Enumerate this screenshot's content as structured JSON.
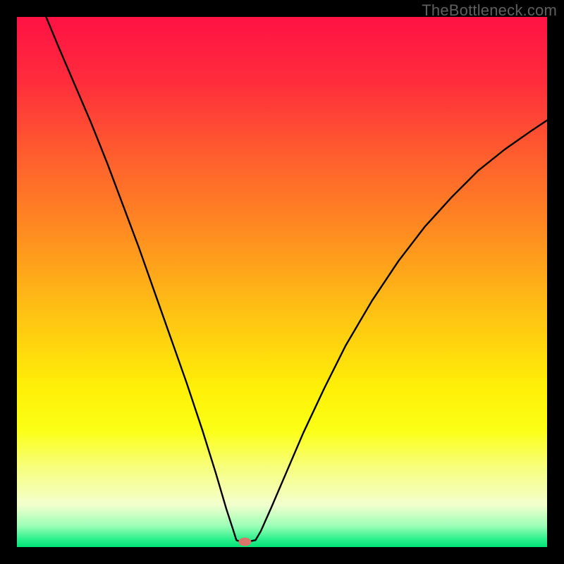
{
  "watermark": "TheBottleneck.com",
  "chart_data": {
    "type": "line",
    "title": "",
    "xlabel": "",
    "ylabel": "",
    "xlim": [
      0,
      1
    ],
    "ylim": [
      0,
      1
    ],
    "gradient_stops": [
      {
        "offset": 0.0,
        "color": "#ff1244"
      },
      {
        "offset": 0.12,
        "color": "#ff2c3c"
      },
      {
        "offset": 0.25,
        "color": "#ff5a2f"
      },
      {
        "offset": 0.4,
        "color": "#ff8a21"
      },
      {
        "offset": 0.55,
        "color": "#ffbf14"
      },
      {
        "offset": 0.7,
        "color": "#fff007"
      },
      {
        "offset": 0.78,
        "color": "#fbff16"
      },
      {
        "offset": 0.85,
        "color": "#f7ff7d"
      },
      {
        "offset": 0.92,
        "color": "#f3ffce"
      },
      {
        "offset": 0.96,
        "color": "#9cffb7"
      },
      {
        "offset": 0.985,
        "color": "#2cf08c"
      },
      {
        "offset": 1.0,
        "color": "#00e376"
      }
    ],
    "marker": {
      "x": 0.43,
      "y": 0.01,
      "color": "#d8766c"
    },
    "series": [
      {
        "name": "curve",
        "points": [
          {
            "x": 0.055,
            "y": 1.0
          },
          {
            "x": 0.08,
            "y": 0.94
          },
          {
            "x": 0.11,
            "y": 0.87
          },
          {
            "x": 0.14,
            "y": 0.8
          },
          {
            "x": 0.17,
            "y": 0.725
          },
          {
            "x": 0.2,
            "y": 0.645
          },
          {
            "x": 0.23,
            "y": 0.565
          },
          {
            "x": 0.26,
            "y": 0.48
          },
          {
            "x": 0.29,
            "y": 0.395
          },
          {
            "x": 0.32,
            "y": 0.31
          },
          {
            "x": 0.35,
            "y": 0.22
          },
          {
            "x": 0.375,
            "y": 0.14
          },
          {
            "x": 0.395,
            "y": 0.072
          },
          {
            "x": 0.408,
            "y": 0.032
          },
          {
            "x": 0.414,
            "y": 0.013
          },
          {
            "x": 0.42,
            "y": 0.011
          },
          {
            "x": 0.44,
            "y": 0.011
          },
          {
            "x": 0.45,
            "y": 0.013
          },
          {
            "x": 0.46,
            "y": 0.03
          },
          {
            "x": 0.48,
            "y": 0.075
          },
          {
            "x": 0.51,
            "y": 0.145
          },
          {
            "x": 0.54,
            "y": 0.215
          },
          {
            "x": 0.58,
            "y": 0.3
          },
          {
            "x": 0.62,
            "y": 0.38
          },
          {
            "x": 0.67,
            "y": 0.465
          },
          {
            "x": 0.72,
            "y": 0.54
          },
          {
            "x": 0.77,
            "y": 0.605
          },
          {
            "x": 0.82,
            "y": 0.66
          },
          {
            "x": 0.87,
            "y": 0.71
          },
          {
            "x": 0.92,
            "y": 0.75
          },
          {
            "x": 0.97,
            "y": 0.785
          },
          {
            "x": 1.0,
            "y": 0.805
          }
        ]
      }
    ]
  }
}
